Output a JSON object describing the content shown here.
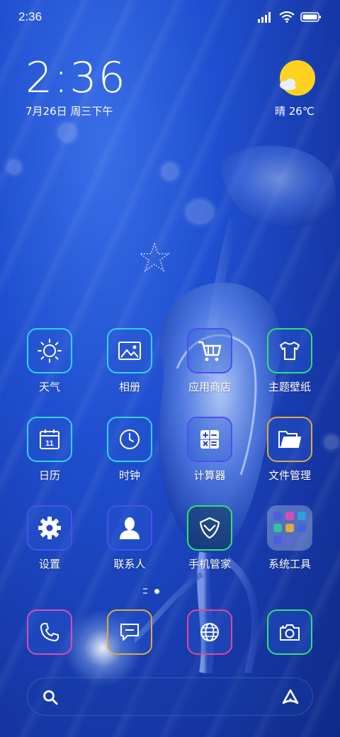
{
  "status_bar": {
    "time": "2:36",
    "icons": [
      "signal-icon",
      "wifi-icon",
      "battery-icon"
    ]
  },
  "clock_widget": {
    "time": "2:36",
    "date": "7月26日 周三下午"
  },
  "weather_widget": {
    "icon": "sunny-cloud-icon",
    "text": "晴 26℃"
  },
  "apps": [
    {
      "label": "天气",
      "icon": "sun-icon",
      "border": "#35d0f2"
    },
    {
      "label": "相册",
      "icon": "image-icon",
      "border": "#35d0f2"
    },
    {
      "label": "应用商店",
      "icon": "cart-icon",
      "border": "#4a50f0"
    },
    {
      "label": "主题壁纸",
      "icon": "tshirt-icon",
      "border": "#2ee07a"
    },
    {
      "label": "日历",
      "icon": "calendar-icon",
      "border": "#35d0f2",
      "badge": "11"
    },
    {
      "label": "时钟",
      "icon": "clock-icon",
      "border": "#35d0f2"
    },
    {
      "label": "计算器",
      "icon": "calculator-icon",
      "border": "#4a50f0"
    },
    {
      "label": "文件管理",
      "icon": "folder-icon",
      "border": "#e0a840"
    },
    {
      "label": "设置",
      "icon": "gear-icon",
      "border": "#4a50f0"
    },
    {
      "label": "联系人",
      "icon": "person-icon",
      "border": "#4a50f0"
    },
    {
      "label": "手机管家",
      "icon": "shield-icon",
      "border": "#2ee07a"
    },
    {
      "label": "系统工具",
      "icon": "folder-group-icon",
      "border": "none"
    }
  ],
  "page_indicator": {
    "pages": 2,
    "current": 1
  },
  "dock": [
    {
      "icon": "phone-icon",
      "border": "#d04fb8"
    },
    {
      "icon": "message-icon",
      "border": "#e0a840"
    },
    {
      "icon": "browser-globe-icon",
      "border": "#e04a8a"
    },
    {
      "icon": "camera-icon",
      "border": "#2ee07a"
    }
  ],
  "search_bar": {
    "left_icon": "search-icon",
    "right_icon": "assistant-icon"
  }
}
